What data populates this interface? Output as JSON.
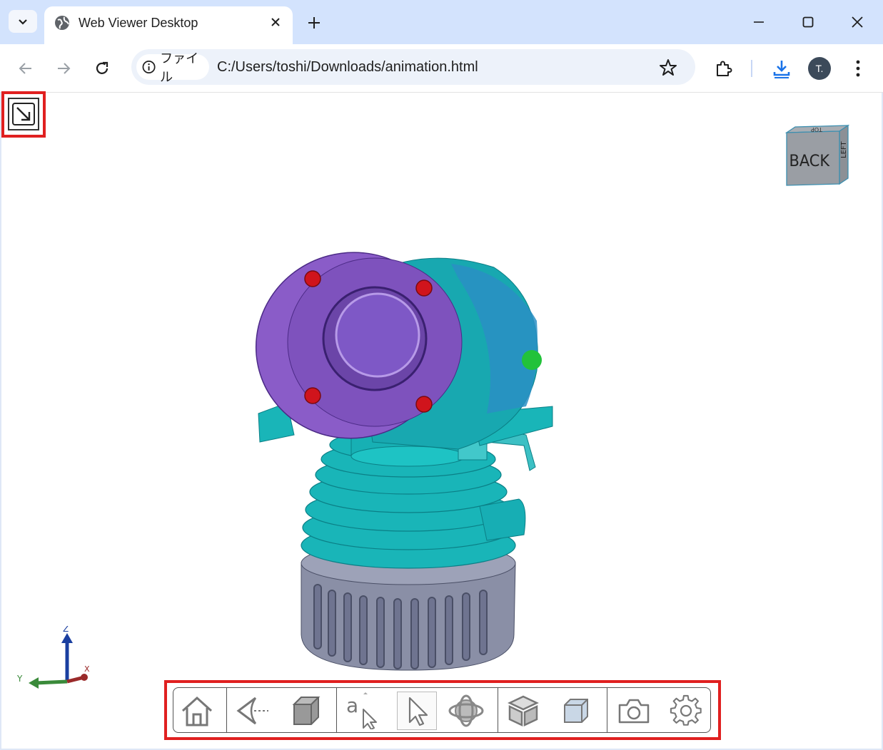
{
  "browser": {
    "tab_title": "Web Viewer Desktop",
    "chip_label": "ファイル",
    "url": "C:/Users/toshi/Downloads/animation.html",
    "avatar_initial": "T."
  },
  "viewer": {
    "navcube": {
      "front_face": "BACK",
      "side_face": "LEFT",
      "top_face": "TOP"
    },
    "triad": {
      "z": "Z",
      "y": "Y",
      "x": "X"
    }
  },
  "viewer_toolbar": {
    "items": [
      {
        "icon": "home-icon"
      },
      {
        "icon": "camera-view-icon"
      },
      {
        "icon": "shaded-cube-icon"
      },
      {
        "icon": "annotate-select-icon"
      },
      {
        "icon": "select-pointer-icon",
        "active": true
      },
      {
        "icon": "orbit-icon"
      },
      {
        "icon": "explode-model-icon"
      },
      {
        "icon": "cutting-plane-icon"
      },
      {
        "icon": "snapshot-camera-icon"
      },
      {
        "icon": "settings-gear-icon"
      }
    ]
  },
  "colors": {
    "tab_strip": "#d3e3fd",
    "highlight": "#e02020",
    "model_teal": "#19b5b8",
    "model_purple": "#8a5cc8",
    "model_bolt": "#d0141c",
    "model_grey": "#8a8fa6"
  }
}
